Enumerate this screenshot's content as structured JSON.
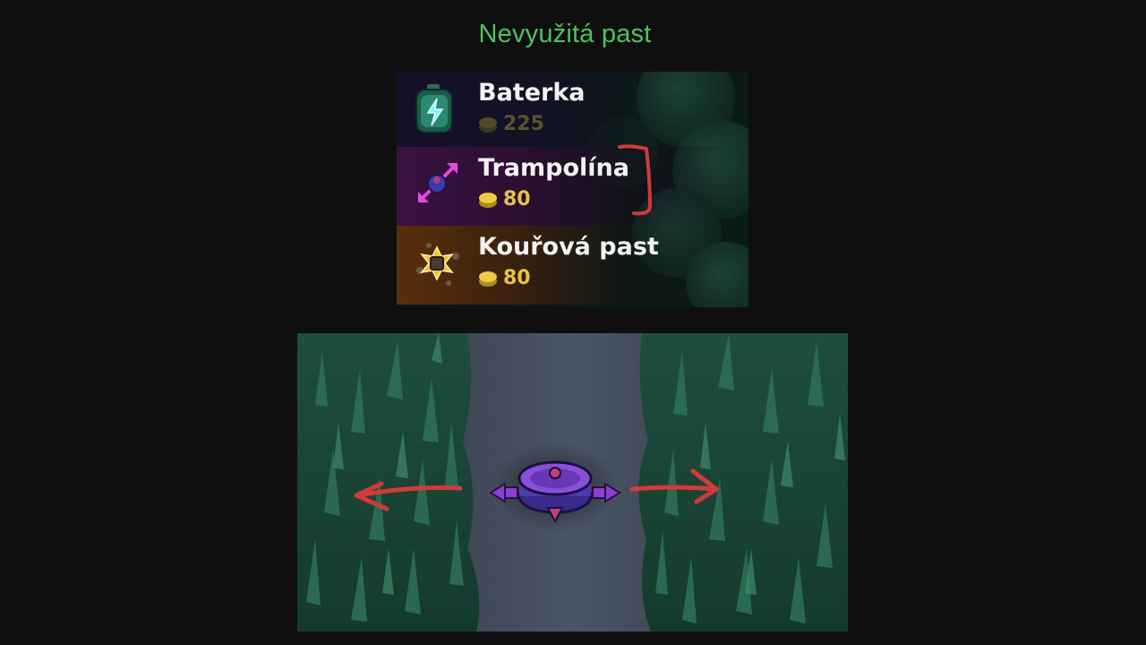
{
  "title": "Nevyužitá past",
  "shop": {
    "items": [
      {
        "name": "Baterka",
        "price": "225",
        "icon": "battery-icon",
        "affordable": false
      },
      {
        "name": "Trampolína",
        "price": "80",
        "icon": "trampoline-icon",
        "affordable": true
      },
      {
        "name": "Kouřová past",
        "price": "80",
        "icon": "smoke-trap-icon",
        "affordable": true
      }
    ]
  },
  "colors": {
    "title": "#4cc35e",
    "annotation": "#d23a3a",
    "coin": "#e8c24a",
    "trampoline": "#7a3fc0"
  }
}
